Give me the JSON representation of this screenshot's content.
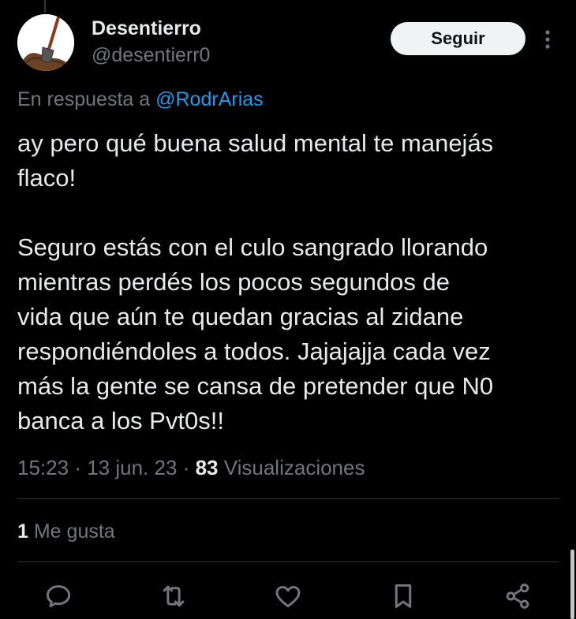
{
  "author": {
    "display_name": "Desentierro",
    "handle": "@desentierr0"
  },
  "follow_label": "Seguir",
  "reply_context": {
    "prefix": "En respuesta a",
    "mention": "@RodrArias"
  },
  "tweet": {
    "text": "ay pero qué buena salud mental te manejás\nflaco!\n\nSeguro estás con el culo sangrado llorando\nmientras perdés los pocos segundos de\nvida que aún te quedan  gracias al zidane\nrespondiéndoles a todos. Jajajajja cada vez\nmás la gente se cansa de pretender que N0\nbanca a los Pvt0s!!",
    "time": "15:23",
    "separator": "·",
    "date": "13 jun. 23",
    "view_count": "83",
    "view_label": "Visualizaciones"
  },
  "engagement": {
    "like_count": "1",
    "like_label": "Me gusta"
  },
  "actions": [
    {
      "name": "reply",
      "icon": "speech-bubble-icon"
    },
    {
      "name": "retweet",
      "icon": "retweet-arrows-icon"
    },
    {
      "name": "like",
      "icon": "heart-icon"
    },
    {
      "name": "bookmark",
      "icon": "bookmark-icon"
    },
    {
      "name": "share",
      "icon": "share-nodes-icon"
    }
  ],
  "colors": {
    "background": "#000000",
    "text_primary": "#e7e9ea",
    "text_secondary": "#71767b",
    "link": "#1d9bf0",
    "divider": "#2f3336",
    "follow_button_bg": "#eff3f4",
    "icon": "#71767b"
  }
}
